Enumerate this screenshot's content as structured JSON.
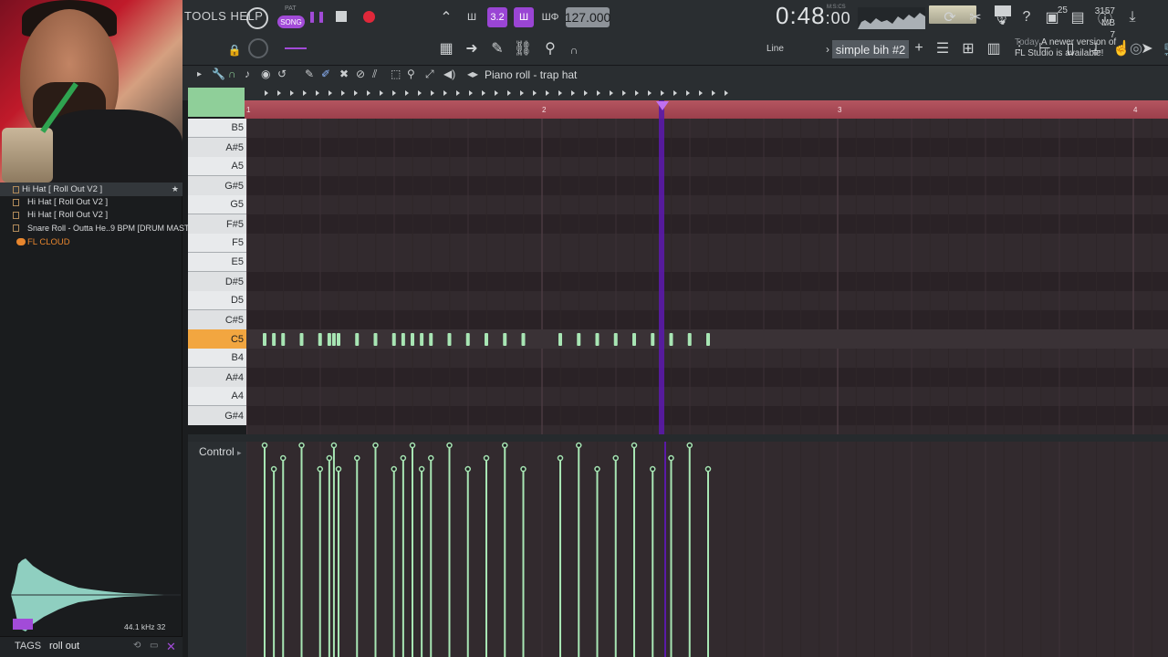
{
  "app": {
    "name": "FL Studio"
  },
  "menu": {
    "text": "TOOLS HELP"
  },
  "transport": {
    "pat_label": "PAT",
    "song_label": "SONG",
    "tempo": "127.000",
    "time_main": "0:48",
    "time_sub": ":00",
    "time_unit": "M:S:CS",
    "cpu_value": "25",
    "ram_mb": "3157 MB",
    "ram_poly": "7",
    "step_label": "3.2"
  },
  "toolbar2": {
    "snap_label": "Line",
    "pattern_name": "simple bih #2",
    "news_date": "Today",
    "news_text_1": "A newer version of",
    "news_text_2": "FL Studio is available!"
  },
  "browser": {
    "items": [
      {
        "label": "Hi Hat [ Roll Out V2 ]"
      },
      {
        "label": "Hi Hat [ Roll Out V2 ]"
      },
      {
        "label": "Hi Hat [ Roll Out V2 ]"
      },
      {
        "label": "Snare Roll - Outta He..9 BPM [DRUM MASTERY]"
      }
    ],
    "cloud_label": "FL CLOUD",
    "sample_rate": "44.1 kHz 32",
    "tags_label": "TAGS",
    "tags_value": "roll out"
  },
  "piano_roll": {
    "title": "Piano roll - trap hat",
    "ruler_bars": [
      "1",
      "2",
      "3",
      "4"
    ],
    "keys": [
      "B5",
      "A#5",
      "A5",
      "G#5",
      "G5",
      "F#5",
      "F5",
      "E5",
      "D#5",
      "D5",
      "C#5",
      "C5",
      "B4",
      "A#4",
      "A4",
      "G#4"
    ],
    "active_key": "C5",
    "control_label": "Control",
    "note_beats": [
      0,
      0.25,
      0.5,
      1,
      1.5,
      1.75,
      1.875,
      2,
      2.5,
      3,
      3.5,
      3.75,
      4,
      4.25,
      4.5,
      5,
      5.5,
      6,
      6.5,
      7,
      8,
      8.5,
      9,
      9.5,
      10,
      10.5,
      11,
      11.5,
      12
    ]
  },
  "colors": {
    "accent": "#a24bd8",
    "note": "#a8e6b4",
    "ruler": "#b45560",
    "active_key": "#f2a640",
    "playhead": "#5a1aa8"
  }
}
